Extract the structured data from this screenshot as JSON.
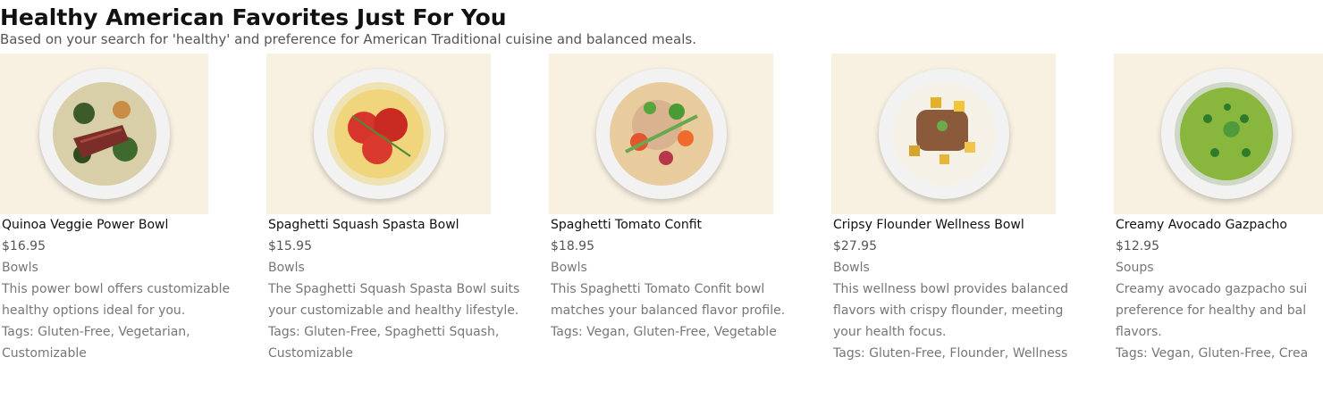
{
  "header": {
    "title": "Healthy American Favorites Just For You",
    "subtitle": "Based on your search for 'healthy' and preference for American Traditional cuisine and balanced meals."
  },
  "cards": [
    {
      "name": "Quinoa Veggie Power Bowl",
      "price": "$16.95",
      "category": "Bowls",
      "desc": [
        "This power bowl offers customizable",
        "healthy options ideal for you."
      ],
      "tags": [
        "Tags: Gluten-Free, Vegetarian,",
        "Customizable"
      ]
    },
    {
      "name": "Spaghetti Squash Spasta Bowl",
      "price": "$15.95",
      "category": "Bowls",
      "desc": [
        "The Spaghetti Squash Spasta Bowl suits",
        "your customizable and healthy lifestyle."
      ],
      "tags": [
        "Tags: Gluten-Free, Spaghetti Squash,",
        "Customizable"
      ]
    },
    {
      "name": "Spaghetti Tomato Confit",
      "price": "$18.95",
      "category": "Bowls",
      "desc": [
        "This Spaghetti Tomato Confit bowl",
        "matches your balanced flavor profile."
      ],
      "tags": [
        "Tags: Vegan, Gluten-Free, Vegetable",
        ""
      ]
    },
    {
      "name": "Cripsy Flounder Wellness Bowl",
      "price": "$27.95",
      "category": "Bowls",
      "desc": [
        "This wellness bowl provides balanced",
        "flavors with crispy flounder, meeting",
        "your health focus."
      ],
      "tags": [
        "Tags: Gluten-Free, Flounder, Wellness",
        ""
      ]
    },
    {
      "name": "Creamy Avocado Gazpacho",
      "price": "$12.95",
      "category": "Soups",
      "desc": [
        "Creamy avocado gazpacho sui",
        "preference for healthy and bal",
        "flavors."
      ],
      "tags": [
        "Tags: Vegan, Gluten-Free, Crea",
        ""
      ]
    }
  ]
}
